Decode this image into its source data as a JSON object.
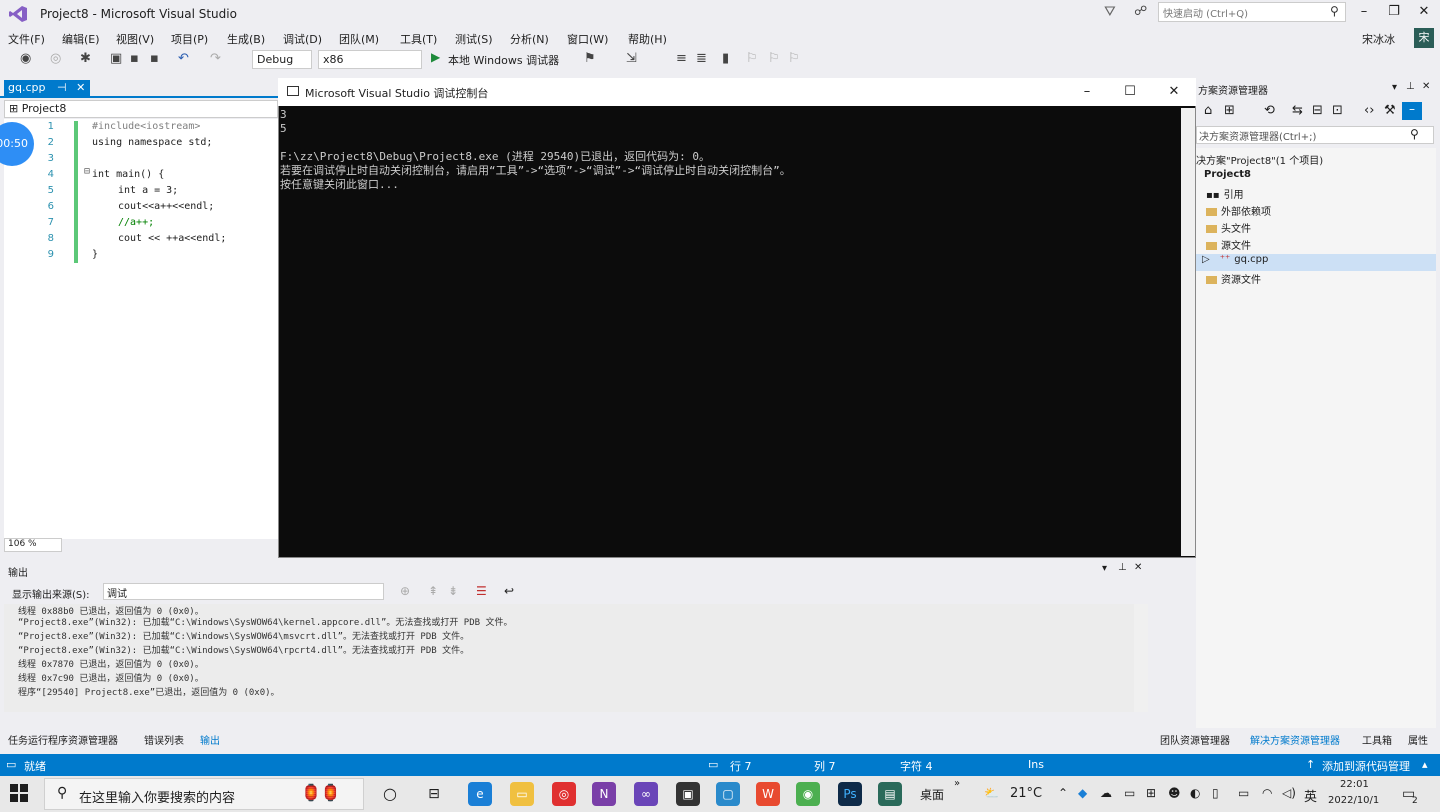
{
  "window": {
    "title": "Project8 - Microsoft Visual Studio",
    "quick_launch_placeholder": "快速启动 (Ctrl+Q)",
    "user_name": "宋冰冰",
    "user_initial": "宋"
  },
  "menu": [
    "文件(F)",
    "编辑(E)",
    "视图(V)",
    "项目(P)",
    "生成(B)",
    "调试(D)",
    "团队(M)",
    "工具(T)",
    "测试(S)",
    "分析(N)",
    "窗口(W)",
    "帮助(H)"
  ],
  "toolbar": {
    "configuration": "Debug",
    "platform": "x86",
    "run_label": "本地 Windows 调试器"
  },
  "editor": {
    "tab_name": "gq.cpp",
    "nav_project": "Project8",
    "timer": "00:50",
    "zoom": "106 %",
    "lines": [
      {
        "num": "1",
        "text": "#include<iostream>"
      },
      {
        "num": "2",
        "text": "using namespace std;"
      },
      {
        "num": "3",
        "text": ""
      },
      {
        "num": "4",
        "text": "int main() {"
      },
      {
        "num": "5",
        "text": "int a = 3;"
      },
      {
        "num": "6",
        "text": "cout<<a++<<endl;"
      },
      {
        "num": "7",
        "text": "//a++;"
      },
      {
        "num": "8",
        "text": "cout << ++a<<endl;"
      },
      {
        "num": "9",
        "text": "}"
      }
    ]
  },
  "console": {
    "title": "Microsoft Visual Studio 调试控制台",
    "lines": [
      "3",
      "5",
      "",
      "F:\\zz\\Project8\\Debug\\Project8.exe (进程 29540)已退出，返回代码为: 0。",
      "若要在调试停止时自动关闭控制台，请启用“工具”->“选项”->“调试”->“调试停止时自动关闭控制台”。",
      "按任意键关闭此窗口..."
    ]
  },
  "solution_explorer": {
    "title": "方案资源管理器",
    "search_placeholder": "决方案资源管理器(Ctrl+;)",
    "items": [
      {
        "label": "决方案\"Project8\"(1 个项目)"
      },
      {
        "label": "Project8"
      },
      {
        "label": "引用"
      },
      {
        "label": "外部依赖项"
      },
      {
        "label": "头文件"
      },
      {
        "label": "源文件"
      },
      {
        "label": "gq.cpp"
      },
      {
        "label": "资源文件"
      }
    ],
    "tabs": [
      "团队资源管理器",
      "解决方案资源管理器",
      "工具箱",
      "属性"
    ]
  },
  "output": {
    "title": "输出",
    "source_label": "显示输出来源(S):",
    "source_value": "调试",
    "lines": [
      "线程 0x88b0 已退出，返回值为 0 (0x0)。",
      "“Project8.exe”(Win32): 已加载“C:\\Windows\\SysWOW64\\kernel.appcore.dll”。无法查找或打开 PDB 文件。",
      "“Project8.exe”(Win32): 已加载“C:\\Windows\\SysWOW64\\msvcrt.dll”。无法查找或打开 PDB 文件。",
      "“Project8.exe”(Win32): 已加载“C:\\Windows\\SysWOW64\\rpcrt4.dll”。无法查找或打开 PDB 文件。",
      "线程 0x7870 已退出，返回值为 0 (0x0)。",
      "线程 0x7c90 已退出，返回值为 0 (0x0)。",
      "程序“[29540] Project8.exe”已退出，返回值为 0 (0x0)。"
    ],
    "tabs": [
      "任务运行程序资源管理器",
      "错误列表",
      "输出"
    ]
  },
  "statusbar": {
    "ready": "就绪",
    "line": "行 7",
    "col": "列 7",
    "char": "字符 4",
    "mode": "Ins",
    "source_control": "添加到源代码管理"
  },
  "taskbar": {
    "search_placeholder": "在这里输入你要搜索的内容",
    "desktop_label": "桌面",
    "weather": "21°C",
    "ime": "英",
    "time": "22:01",
    "date": "2022/10/1",
    "notifications": "2"
  },
  "colors": {
    "accent": "#007acc",
    "console_bg": "#0c0c0c",
    "console_text": "#cccccc",
    "change_bar": "#5cc878"
  }
}
